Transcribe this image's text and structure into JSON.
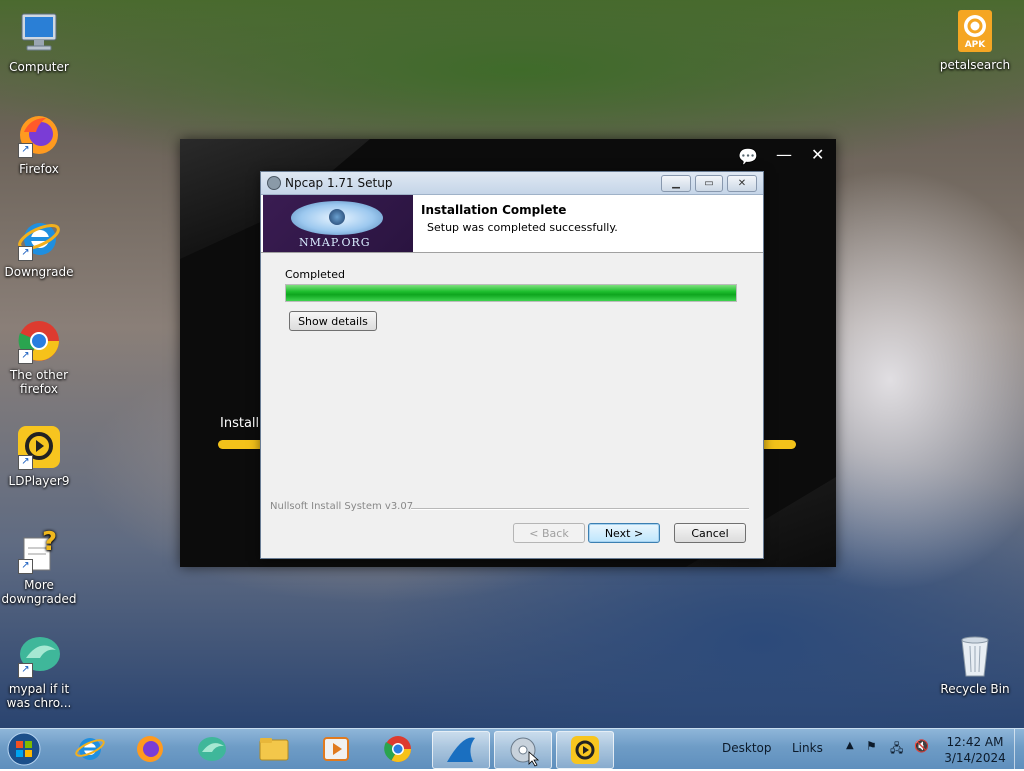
{
  "desktop": {
    "icons_left": [
      {
        "label": "Computer",
        "icon": "computer-icon"
      },
      {
        "label": "Firefox",
        "icon": "firefox-icon"
      },
      {
        "label": "Downgrade",
        "icon": "internet-explorer-icon"
      },
      {
        "label": "The other firefox",
        "icon": "chrome-icon"
      },
      {
        "label": "LDPlayer9",
        "icon": "ldplayer-icon"
      },
      {
        "label": "More downgraded",
        "icon": "help-document-icon"
      },
      {
        "label": "mypal if it was chro...",
        "icon": "mypal-icon"
      }
    ],
    "icons_right": [
      {
        "label": "petalsearch",
        "icon": "apk-icon",
        "badge": "APK"
      },
      {
        "label": "Recycle Bin",
        "icon": "recycle-bin-icon"
      }
    ]
  },
  "background_installer": {
    "status_text": "Installin",
    "progress_color": "#f3c21a"
  },
  "dialog": {
    "title": "Npcap 1.71 Setup",
    "logo_text": "NMAP.ORG",
    "header_title": "Installation Complete",
    "header_subtitle": "Setup was completed successfully.",
    "progress_label": "Completed",
    "progress": 1.0,
    "show_details_label": "Show details",
    "branding": "Nullsoft Install System v3.07",
    "back_label": "< Back",
    "next_label": "Next >",
    "cancel_label": "Cancel"
  },
  "taskbar": {
    "desktop_label": "Desktop",
    "links_label": "Links",
    "time": "12:42 AM",
    "date": "3/14/2024"
  },
  "colors": {
    "progress_green": "#1fbf2f",
    "taskbar": "#6e9cc6"
  }
}
